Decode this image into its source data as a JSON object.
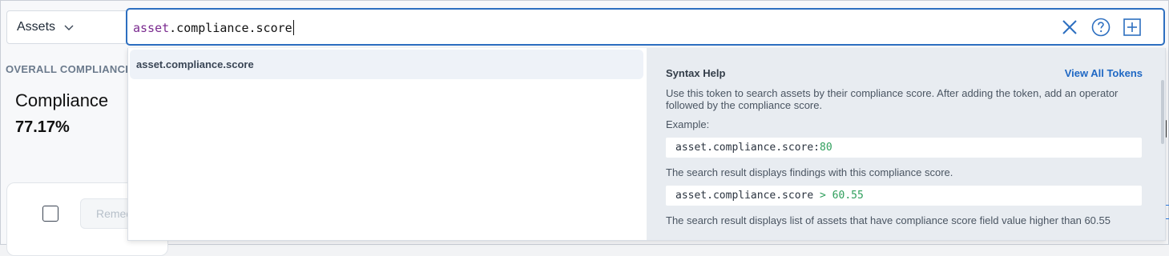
{
  "scope_selector": {
    "label": "Assets"
  },
  "search": {
    "token": "asset",
    "query_rest": ".compliance.score"
  },
  "background": {
    "section_label": "OVERALL COMPLIANCE",
    "metric_label": "Compliance",
    "metric_value": "77.17%",
    "remediate_button": "Remed"
  },
  "suggestions": [
    {
      "label": "asset.compliance.score"
    }
  ],
  "syntax_help": {
    "title": "Syntax Help",
    "view_all": "View All Tokens",
    "description": "Use this token to search assets by their compliance score. After adding the token, add an operator followed by the compliance score.",
    "example_label": "Example:",
    "example1_token": "asset.compliance.score:",
    "example1_value": "80",
    "example1_desc": "The search result displays findings with this compliance score.",
    "example2_token": "asset.compliance.score ",
    "example2_value": "> 60.55",
    "example2_desc": "The search result displays list of assets that have compliance score field value higher than 60.55"
  },
  "icons": [
    "chevron-down-icon",
    "clear-icon",
    "help-icon",
    "add-icon"
  ],
  "colors": {
    "accent": "#2d6fc0",
    "token": "#7a2a8f",
    "code_value": "#2e9e5b",
    "link": "#1f68c4"
  }
}
